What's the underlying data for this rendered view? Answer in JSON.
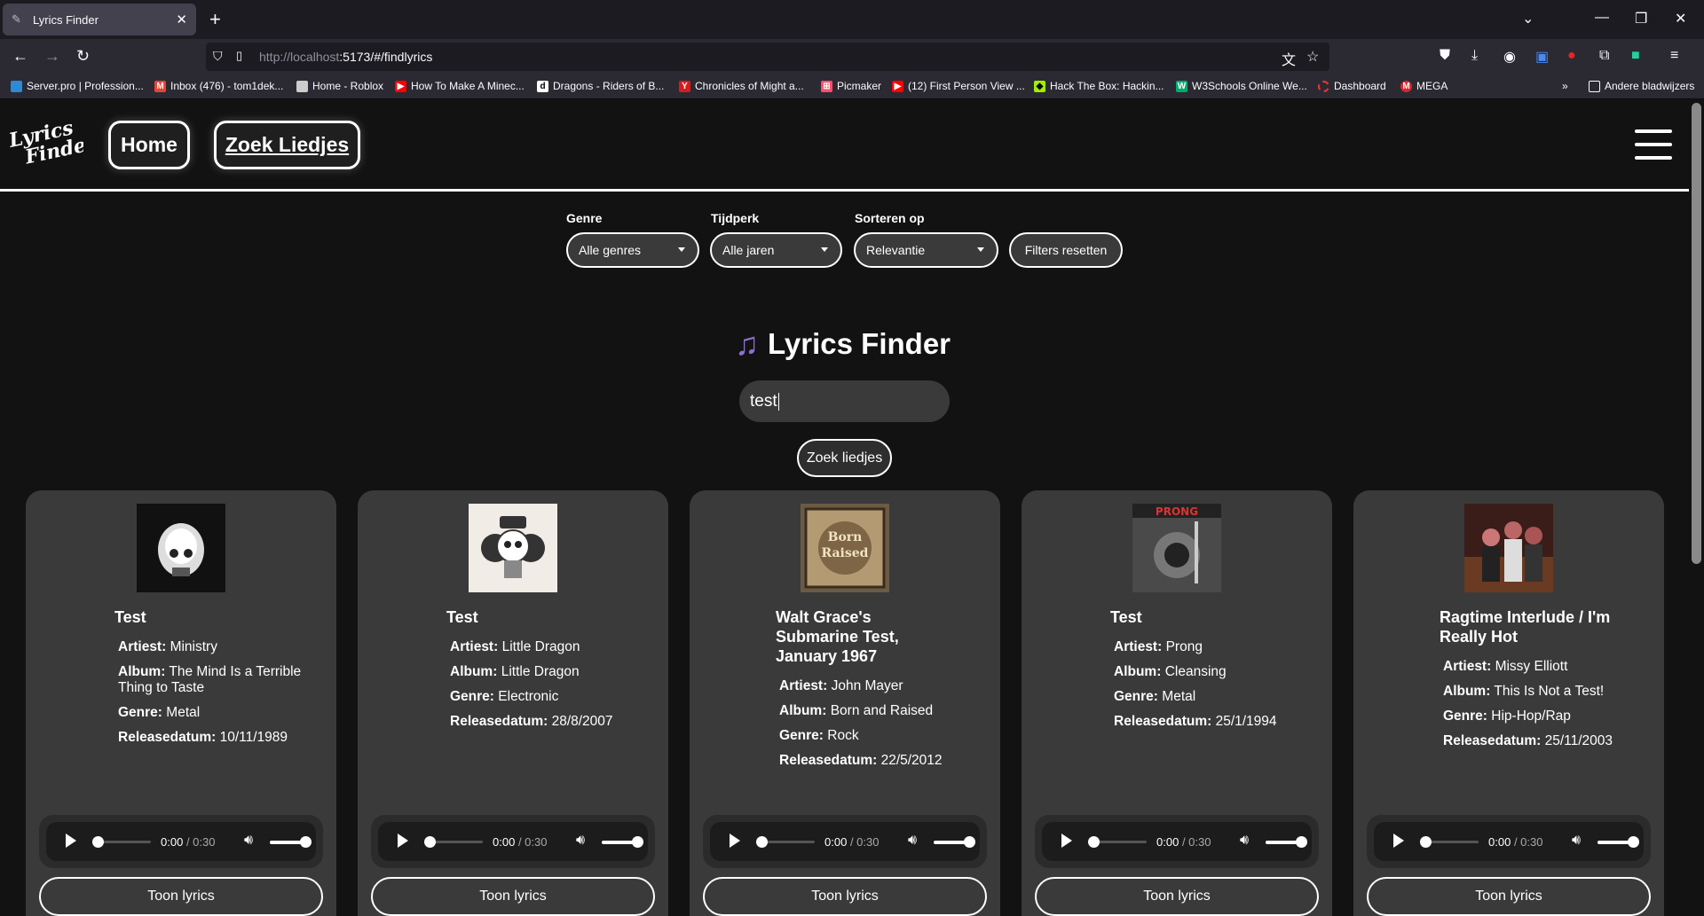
{
  "browser": {
    "tab_title": "Lyrics Finder",
    "url_host": "http://localhost",
    "url_path": ":5173/#/findlyrics",
    "bookmarks": [
      {
        "label": "Server.pro | Profession...",
        "color": "#2c8ad8"
      },
      {
        "label": "Inbox (476) - tom1dek...",
        "color": "#ea4335"
      },
      {
        "label": "Home - Roblox",
        "color": "#cccccc"
      },
      {
        "label": "How To Make A Minec...",
        "color": "#ff0000"
      },
      {
        "label": "Dragons - Riders of B...",
        "color": "#ffffff"
      },
      {
        "label": "Chronicles of Might a...",
        "color": "#d81b1b"
      },
      {
        "label": "Picmaker",
        "color": "#ff4f6d"
      },
      {
        "label": "(12) First Person View ...",
        "color": "#ff0000"
      },
      {
        "label": "Hack The Box: Hackin...",
        "color": "#9fef00"
      },
      {
        "label": "W3Schools Online We...",
        "color": "#04aa6d"
      },
      {
        "label": "Dashboard",
        "color": "#e33"
      },
      {
        "label": "MEGA",
        "color": "#d9272e"
      }
    ],
    "other_bookmarks": "Andere bladwijzers"
  },
  "header": {
    "logo_text": "Lyrics Finder",
    "nav": [
      {
        "label": "Home"
      },
      {
        "label": "Zoek Liedjes"
      }
    ]
  },
  "filters": {
    "genre_label": "Genre",
    "genre_value": "Alle genres",
    "era_label": "Tijdperk",
    "era_value": "Alle jaren",
    "sort_label": "Sorteren op",
    "sort_value": "Relevantie",
    "reset_label": "Filters resetten"
  },
  "main": {
    "title": "Lyrics Finder",
    "search_value": "test",
    "search_button": "Zoek liedjes"
  },
  "labels": {
    "artist": "Artiest:",
    "album": "Album:",
    "genre": "Genre:",
    "release": "Releasedatum:",
    "show_lyrics": "Toon lyrics",
    "time_current": "0:00",
    "time_total": "0:30"
  },
  "results": [
    {
      "title": "Test",
      "artist": "Ministry",
      "album": "The Mind Is a Terrible Thing to Taste",
      "genre": "Metal",
      "release": "10/11/1989"
    },
    {
      "title": "Test",
      "artist": "Little Dragon",
      "album": "Little Dragon",
      "genre": "Electronic",
      "release": "28/8/2007"
    },
    {
      "title": "Walt Grace's Submarine Test, January 1967",
      "artist": "John Mayer",
      "album": "Born and Raised",
      "genre": "Rock",
      "release": "22/5/2012"
    },
    {
      "title": "Test",
      "artist": "Prong",
      "album": "Cleansing",
      "genre": "Metal",
      "release": "25/1/1994"
    },
    {
      "title": "Ragtime Interlude / I'm Really Hot",
      "artist": "Missy Elliott",
      "album": "This Is Not a Test!",
      "genre": "Hip-Hop/Rap",
      "release": "25/11/2003"
    }
  ]
}
